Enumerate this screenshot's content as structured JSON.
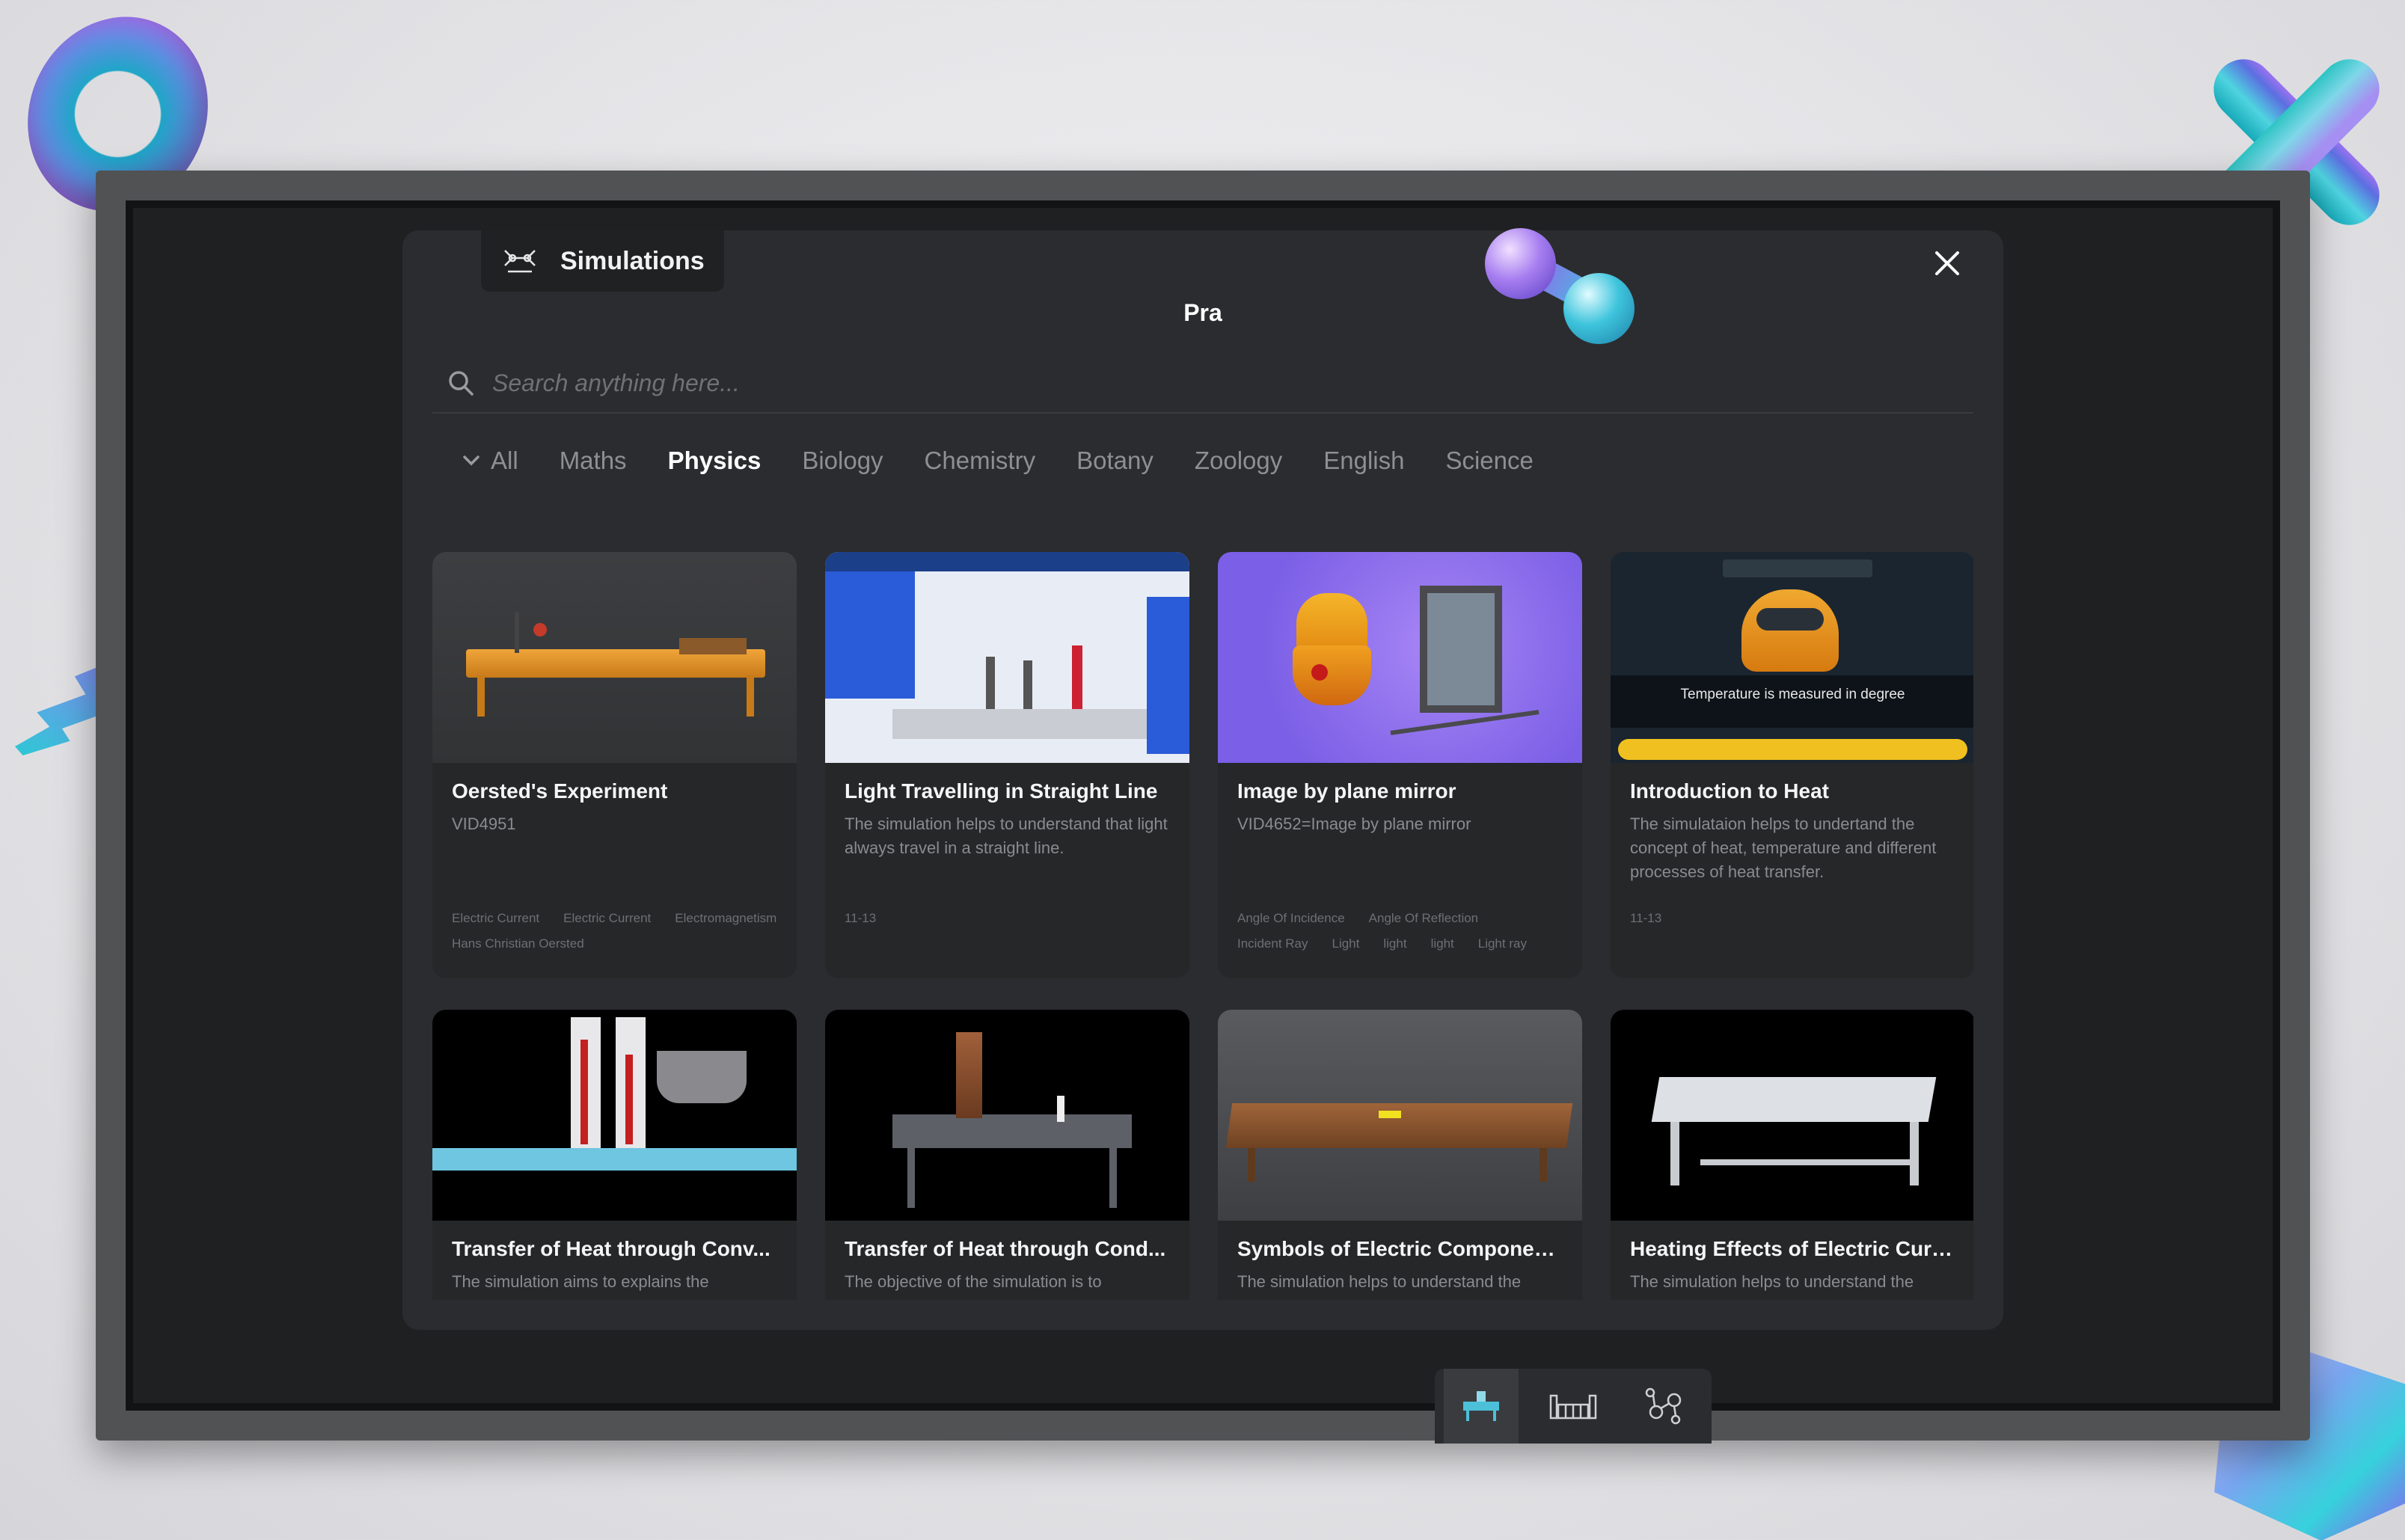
{
  "modal": {
    "tab_label": "Simulations",
    "title": "Pra",
    "close_icon": "×"
  },
  "search": {
    "placeholder": "Search anything here..."
  },
  "filters": [
    {
      "label": "All",
      "active": false
    },
    {
      "label": "Maths",
      "active": false
    },
    {
      "label": "Physics",
      "active": true
    },
    {
      "label": "Biology",
      "active": false
    },
    {
      "label": "Chemistry",
      "active": false
    },
    {
      "label": "Botany",
      "active": false
    },
    {
      "label": "Zoology",
      "active": false
    },
    {
      "label": "English",
      "active": false
    },
    {
      "label": "Science",
      "active": false
    }
  ],
  "cards": [
    {
      "title": "Oersted's Experiment",
      "desc": "VID4951",
      "tags": [
        "Electric Current",
        "Electric Current",
        "Electromagnetism",
        "Hans Christian Oersted"
      ]
    },
    {
      "title": "Light Travelling in Straight Line",
      "desc": "The simulation helps to understand that light\nalways travel in a straight line.",
      "age": "11-13"
    },
    {
      "title": "Image by plane mirror",
      "desc": "VID4652=Image by plane mirror",
      "tags": [
        "Angle Of Incidence",
        "Angle Of Reflection",
        "Incident Ray",
        "Light",
        "light",
        "light",
        "Light ray"
      ]
    },
    {
      "title": "Introduction to Heat",
      "desc": "The simulataion helps to undertand the concept of heat, temperature and different processes of heat transfer.",
      "age": "11-13",
      "thumb_text": "Temperature is measured in degree"
    },
    {
      "title": "Transfer of Heat through Conv...",
      "desc": "The simulation aims to explains the"
    },
    {
      "title": "Transfer of Heat through Cond...",
      "desc": "The objective of the simulation is to"
    },
    {
      "title": "Symbols of Electric Componen...",
      "desc": "The simulation helps to understand the"
    },
    {
      "title": "Heating Effects of Electric Curr...",
      "desc": "The simulation helps to understand the"
    }
  ],
  "dock": [
    {
      "icon": "simulation-lab-icon",
      "active": true
    },
    {
      "icon": "periodic-table-icon",
      "active": false
    },
    {
      "icon": "molecule-icon",
      "active": false
    }
  ],
  "colors": {
    "modal_bg": "#2b2c2f",
    "active_filter": "#ffffff",
    "inactive_filter": "#8e8f93"
  }
}
